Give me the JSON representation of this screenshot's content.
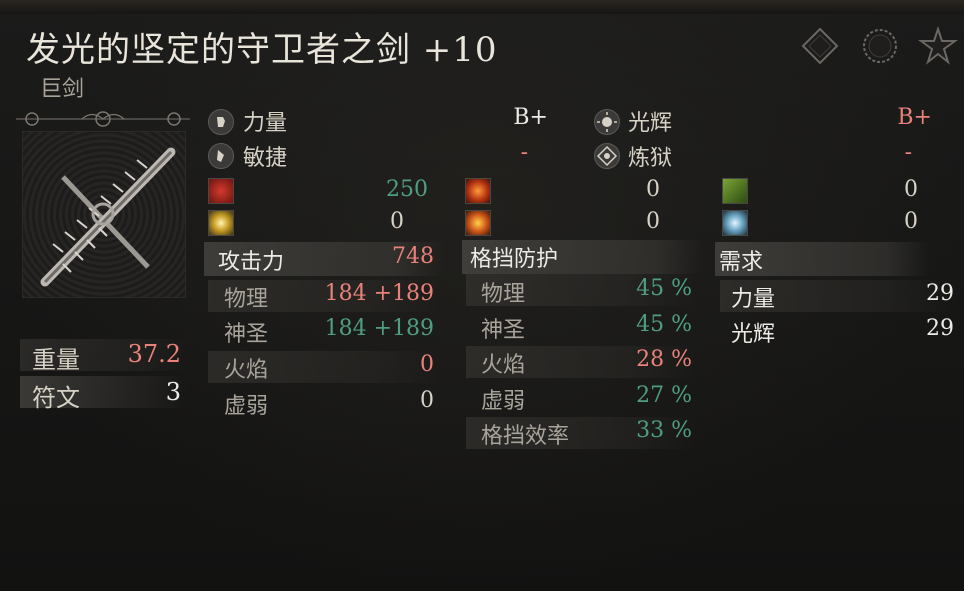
{
  "item": {
    "name": "发光的坚定的守卫者之剑 +10",
    "category": "巨剑"
  },
  "header_icons": [
    "diamond-icon",
    "circle-icon",
    "star-icon"
  ],
  "scaling": [
    {
      "label": "力量",
      "grade": "B+",
      "icon": "strength-icon"
    },
    {
      "label": "敏捷",
      "grade": "-",
      "icon": "dexterity-icon"
    },
    {
      "label": "光辉",
      "grade": "B+",
      "icon": "faith-icon"
    },
    {
      "label": "炼狱",
      "grade": "-",
      "icon": "arcane-icon"
    }
  ],
  "passive_effects": [
    {
      "icon": "blood-icon",
      "value": "250"
    },
    {
      "icon": "holy-light-icon",
      "value": "0"
    },
    {
      "icon": "fire-icon",
      "value": "0"
    },
    {
      "icon": "flame-burst-icon",
      "value": "0"
    },
    {
      "icon": "poison-icon",
      "value": "0"
    },
    {
      "icon": "frost-icon",
      "value": "0"
    }
  ],
  "attack": {
    "header": "攻击力",
    "total": "748",
    "rows": [
      {
        "label": "物理",
        "value": "184 +189"
      },
      {
        "label": "神圣",
        "value": "184 +189"
      },
      {
        "label": "火焰",
        "value": "0"
      },
      {
        "label": "虚弱",
        "value": "0"
      }
    ]
  },
  "guard": {
    "header": "格挡防护",
    "rows": [
      {
        "label": "物理",
        "value": "45 %"
      },
      {
        "label": "神圣",
        "value": "45 %"
      },
      {
        "label": "火焰",
        "value": "28 %"
      },
      {
        "label": "虚弱",
        "value": "27 %"
      },
      {
        "label": "格挡效率",
        "value": "33 %"
      }
    ]
  },
  "requirements": {
    "header": "需求",
    "rows": [
      {
        "label": "力量",
        "value": "29"
      },
      {
        "label": "光辉",
        "value": "29"
      }
    ]
  },
  "stats": [
    {
      "label": "重量",
      "value": "37.2"
    },
    {
      "label": "符文",
      "value": "3"
    }
  ],
  "colors": {
    "positive": "#4f9e83",
    "negative": "#e8827a",
    "text": "#d7d2c6"
  }
}
